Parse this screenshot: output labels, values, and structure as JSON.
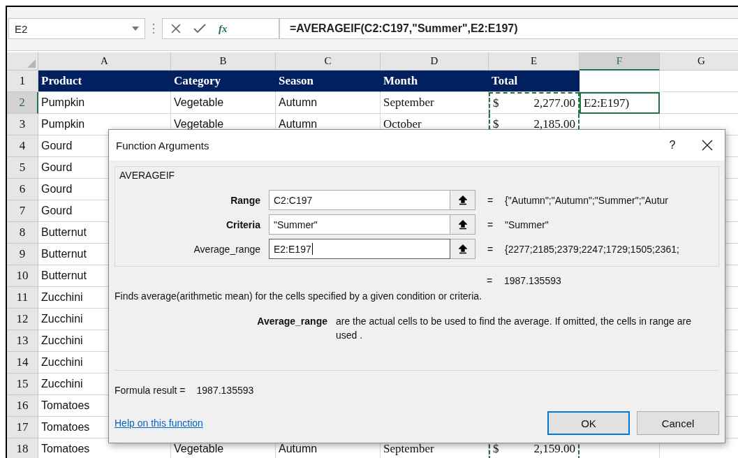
{
  "formula_bar": {
    "name_box": "E2",
    "function_symbol": "fx",
    "formula": "=AVERAGEIF(C2:C197,\"Summer\",E2:E197)"
  },
  "columns": [
    {
      "label": "A",
      "selected": false
    },
    {
      "label": "B",
      "selected": false
    },
    {
      "label": "C",
      "selected": false
    },
    {
      "label": "D",
      "selected": false
    },
    {
      "label": "E",
      "selected": false
    },
    {
      "label": "F",
      "selected": true
    },
    {
      "label": "G",
      "selected": false
    }
  ],
  "rows": [
    {
      "number": "1",
      "kind": "header",
      "selected": false,
      "in_range": false,
      "cells": [
        "Product",
        "Category",
        "Season",
        "Month",
        "Total"
      ]
    },
    {
      "number": "2",
      "kind": "data",
      "selected": true,
      "in_range": true,
      "cells": [
        "Pumpkin",
        "Vegetable",
        "Autumn",
        "September"
      ],
      "total": {
        "currency": "$",
        "amount": "2,277.00"
      },
      "editing": "E2:E197)"
    },
    {
      "number": "3",
      "kind": "data",
      "selected": false,
      "in_range": true,
      "cells": [
        "Pumpkin",
        "Vegetable",
        "Autumn",
        "October"
      ],
      "total": {
        "currency": "$",
        "amount": "2,185.00"
      }
    },
    {
      "number": "4",
      "kind": "data",
      "selected": false,
      "cells": [
        "Gourd"
      ]
    },
    {
      "number": "5",
      "kind": "data",
      "selected": false,
      "cells": [
        "Gourd"
      ]
    },
    {
      "number": "6",
      "kind": "data",
      "selected": false,
      "cells": [
        "Gourd"
      ]
    },
    {
      "number": "7",
      "kind": "data",
      "selected": false,
      "cells": [
        "Gourd"
      ]
    },
    {
      "number": "8",
      "kind": "data",
      "selected": false,
      "cells": [
        "Butternut"
      ]
    },
    {
      "number": "9",
      "kind": "data",
      "selected": false,
      "cells": [
        "Butternut"
      ]
    },
    {
      "number": "10",
      "kind": "data",
      "selected": false,
      "cells": [
        "Butternut"
      ]
    },
    {
      "number": "11",
      "kind": "data",
      "selected": false,
      "cells": [
        "Zucchini"
      ]
    },
    {
      "number": "12",
      "kind": "data",
      "selected": false,
      "cells": [
        "Zucchini"
      ]
    },
    {
      "number": "13",
      "kind": "data",
      "selected": false,
      "cells": [
        "Zucchini"
      ]
    },
    {
      "number": "14",
      "kind": "data",
      "selected": false,
      "cells": [
        "Zucchini"
      ]
    },
    {
      "number": "15",
      "kind": "data",
      "selected": false,
      "cells": [
        "Zucchini"
      ]
    },
    {
      "number": "16",
      "kind": "data",
      "selected": false,
      "cells": [
        "Tomatoes"
      ]
    },
    {
      "number": "17",
      "kind": "data",
      "selected": false,
      "cells": [
        "Tomatoes"
      ]
    },
    {
      "number": "18",
      "kind": "data",
      "selected": false,
      "in_range": true,
      "cells": [
        "Tomatoes",
        "Vegetable",
        "Autumn",
        "September"
      ],
      "total": {
        "currency": "$",
        "amount": "2,159.00"
      }
    }
  ],
  "dialog": {
    "title": "Function Arguments",
    "help": "?",
    "function_name": "AVERAGEIF",
    "arguments": [
      {
        "label": "Range",
        "required": true,
        "value": "C2:C197",
        "focused": false,
        "equals": "=",
        "result": "{\"Autumn\";\"Autumn\";\"Summer\";\"Autur"
      },
      {
        "label": "Criteria",
        "required": true,
        "value": "\"Summer\"",
        "focused": false,
        "equals": "=",
        "result": "\"Summer\""
      },
      {
        "label": "Average_range",
        "required": false,
        "value": "E2:E197",
        "focused": true,
        "equals": "=",
        "result": "{2277;2185;2379;2247;1729;1505;2361;"
      }
    ],
    "result": {
      "equals": "=",
      "value": "1987.135593"
    },
    "description": "Finds average(arithmetic mean) for the cells specified by a given condition or criteria.",
    "argument_help": {
      "name": "Average_range",
      "text": "are the actual cells to be used to find the average. If omitted, the cells in range are used ."
    },
    "formula_result": {
      "label": "Formula result =",
      "value": "1987.135593"
    },
    "help_link": "Help on this function",
    "buttons": [
      {
        "label": "OK",
        "default": true
      },
      {
        "label": "Cancel",
        "default": false
      }
    ]
  }
}
